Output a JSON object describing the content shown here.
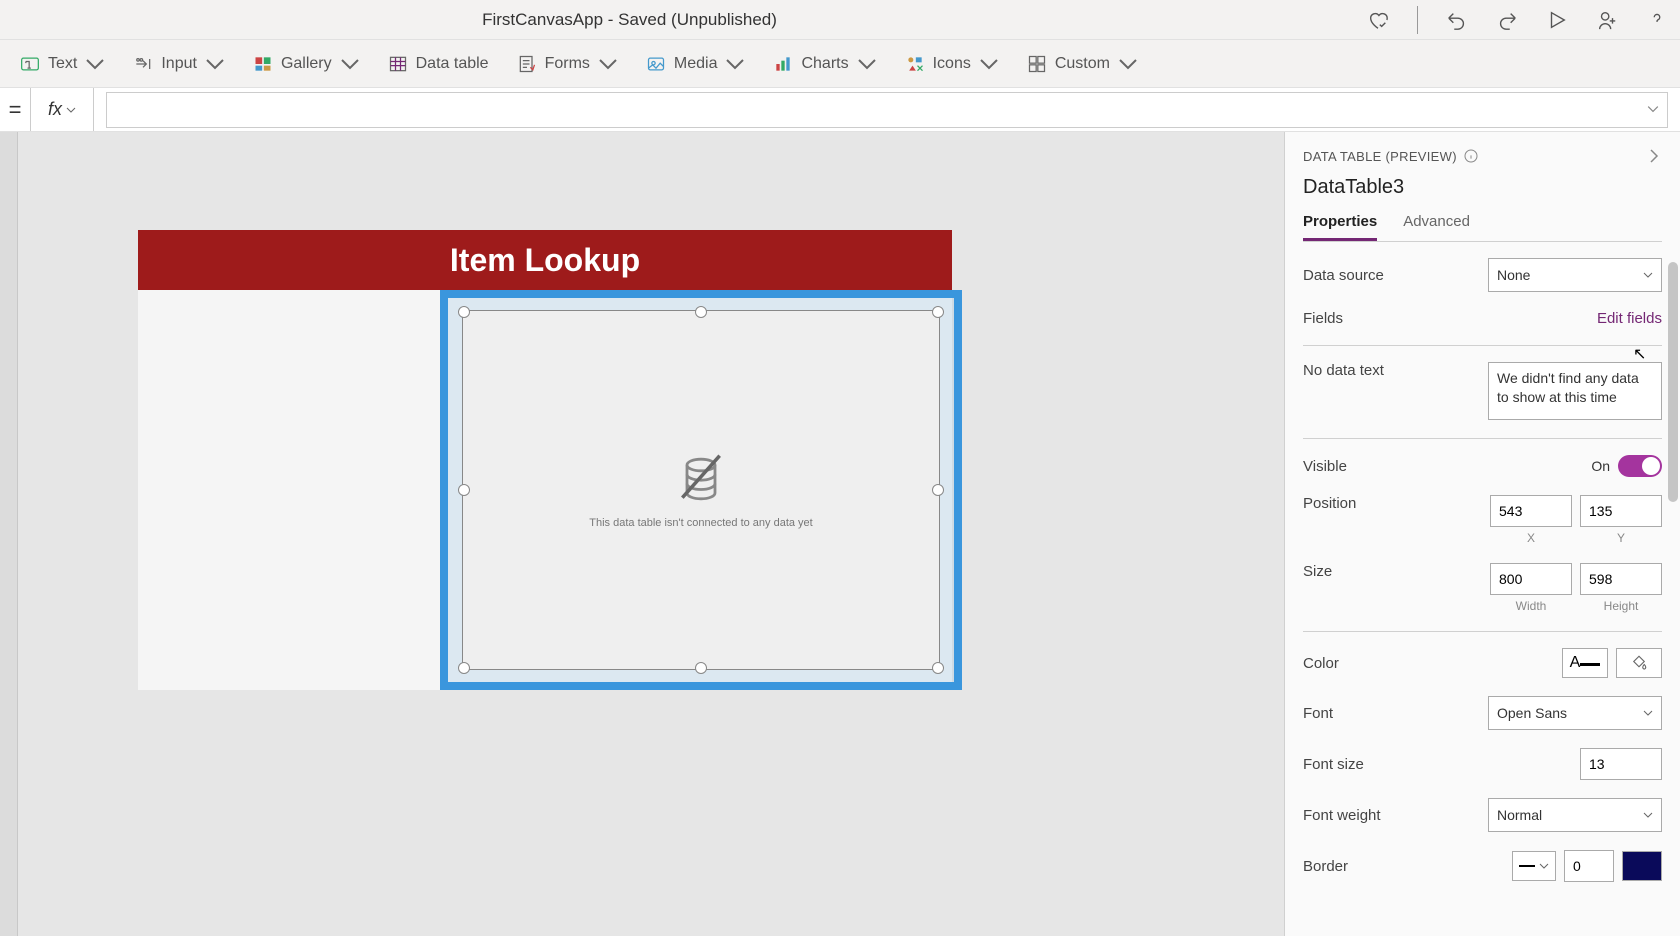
{
  "titlebar": {
    "title": "FirstCanvasApp - Saved (Unpublished)"
  },
  "ribbon": {
    "text": "Text",
    "input": "Input",
    "gallery": "Gallery",
    "datatable": "Data table",
    "forms": "Forms",
    "media": "Media",
    "charts": "Charts",
    "icons": "Icons",
    "custom": "Custom"
  },
  "formula": {
    "eq": "=",
    "fx": "fx",
    "value": ""
  },
  "canvas": {
    "header_title": "Item Lookup",
    "datatable_msg": "This data table isn't connected to any data yet"
  },
  "panel": {
    "header": "DATA TABLE (PREVIEW)",
    "control_name": "DataTable3",
    "tabs": {
      "properties": "Properties",
      "advanced": "Advanced"
    },
    "props": {
      "datasource_label": "Data source",
      "datasource_value": "None",
      "fields_label": "Fields",
      "fields_link": "Edit fields",
      "nodata_label": "No data text",
      "nodata_value": "We didn't find any data to show at this time",
      "visible_label": "Visible",
      "visible_value": "On",
      "position_label": "Position",
      "x": "543",
      "y": "135",
      "x_sub": "X",
      "y_sub": "Y",
      "size_label": "Size",
      "w": "800",
      "h": "598",
      "w_sub": "Width",
      "h_sub": "Height",
      "color_label": "Color",
      "font_label": "Font",
      "font_value": "Open Sans",
      "fontsize_label": "Font size",
      "fontsize_value": "13",
      "fontweight_label": "Font weight",
      "fontweight_value": "Normal",
      "border_label": "Border",
      "border_value": "0"
    }
  }
}
